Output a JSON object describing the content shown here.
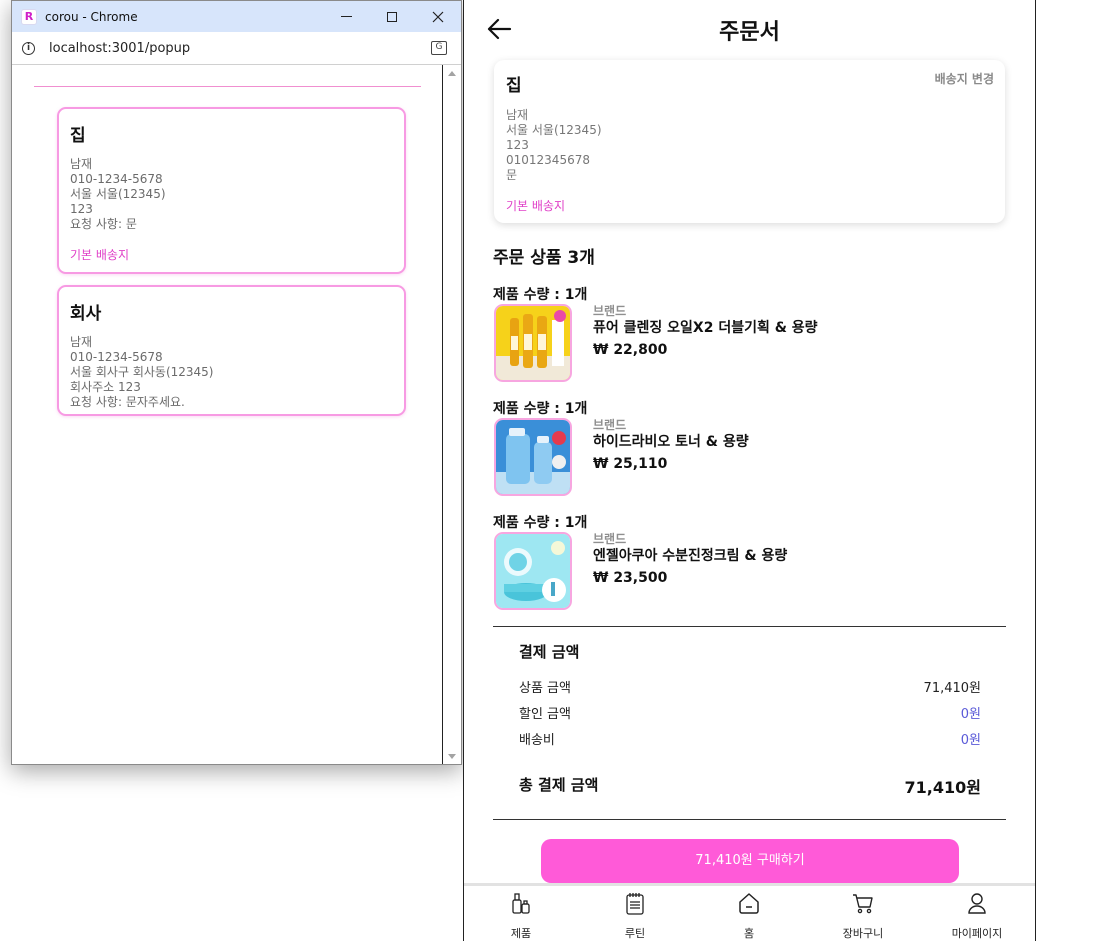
{
  "popup": {
    "window_title": "corou - Chrome",
    "app_icon_letter": "R",
    "url": "localhost:3001/popup",
    "addresses": [
      {
        "name": "집",
        "lines": [
          "남재",
          "010-1234-5678",
          "서울 서울(12345)",
          "123",
          "요청 사항: 문"
        ],
        "default_label": "기본 배송지"
      },
      {
        "name": "회사",
        "lines": [
          "남재",
          "010-1234-5678",
          "서울 회사구 회사동(12345)",
          "회사주소 123",
          "요청 사항: 문자주세요."
        ]
      }
    ]
  },
  "app": {
    "title": "주문서",
    "shipping": {
      "name": "집",
      "change_label": "배송지 변경",
      "lines": [
        "남재",
        "서울 서울(12345)",
        "123",
        "01012345678",
        "문"
      ],
      "default_label": "기본 배송지"
    },
    "products_title": "주문 상품 3개",
    "products": [
      {
        "qty": "제품 수량 : 1개",
        "brand": "브랜드",
        "name": "퓨어 클렌징 오일X2 더블기획 & 용량",
        "price": "₩ 22,800"
      },
      {
        "qty": "제품 수량 : 1개",
        "brand": "브랜드",
        "name": "하이드라비오 토너 & 용량",
        "price": "₩ 25,110"
      },
      {
        "qty": "제품 수량 : 1개",
        "brand": "브랜드",
        "name": "엔젤아쿠아 수분진정크림 & 용량",
        "price": "₩ 23,500"
      }
    ],
    "payment": {
      "title": "결제 금액",
      "rows": [
        {
          "label": "상품 금액",
          "value": "71,410원"
        },
        {
          "label": "할인 금액",
          "value": "0원"
        },
        {
          "label": "배송비",
          "value": "0원"
        }
      ],
      "total_label": "총 결제 금액",
      "total_value": "71,410원"
    },
    "buy_button": "71,410원 구매하기",
    "nav": [
      {
        "label": "제품",
        "icon": "bottles-icon"
      },
      {
        "label": "루틴",
        "icon": "notepad-icon"
      },
      {
        "label": "홈",
        "icon": "home-icon"
      },
      {
        "label": "장바구니",
        "icon": "cart-icon"
      },
      {
        "label": "마이페이지",
        "icon": "user-icon"
      }
    ],
    "accent_color": "#ff5ad8"
  }
}
